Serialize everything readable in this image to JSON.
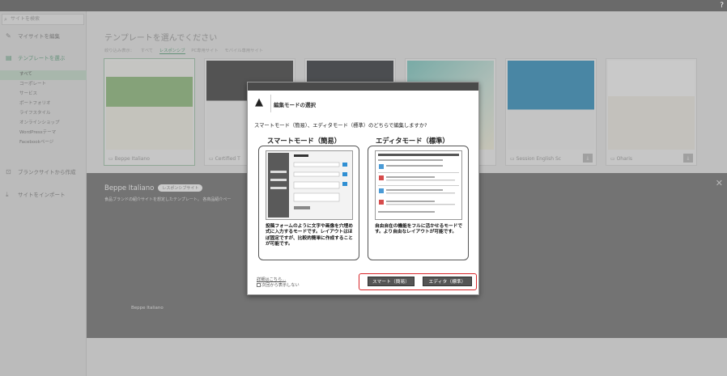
{
  "topbar": {
    "help_icon": "?"
  },
  "sidebar": {
    "search_placeholder": "サイトを検索",
    "items": [
      {
        "label": "マイサイトを編集",
        "icon": "pencil-icon"
      },
      {
        "label": "テンプレートを選ぶ",
        "icon": "template-icon"
      },
      {
        "label": "ブランクサイトから作成",
        "icon": "blank-site-icon"
      },
      {
        "label": "サイトをインポート",
        "icon": "import-icon"
      }
    ],
    "categories": [
      "すべて",
      "コーポレート",
      "サービス",
      "ポートフォリオ",
      "ライフスタイル",
      "オンラインショップ",
      "WordPressテーマ",
      "Facebookページ"
    ]
  },
  "main": {
    "heading": "テンプレートを選んでください",
    "filter_label": "絞り込み表示：",
    "filters": [
      "すべて",
      "レスポンシブ",
      "PC専用サイト",
      "モバイル専用サイト"
    ],
    "cards": [
      {
        "name": "Beppe Italiano"
      },
      {
        "name": "Certified T"
      },
      {
        "name": ""
      },
      {
        "name": ""
      },
      {
        "name": "Session English Sc"
      },
      {
        "name": "Oharis"
      }
    ]
  },
  "detail": {
    "title": "Beppe Italiano",
    "badge": "レスポンシブサイト",
    "description": "食品ブランドの紹介サイトを想定したテンプレート。 各商品紹介ペー",
    "footer_name": "Beppe Italiano"
  },
  "dialog": {
    "title": "編集モードの選択",
    "question": "スマートモード（簡易）、エディタモード（標準）のどちらで編集しますか?",
    "smart": {
      "heading": "スマートモード（簡易）",
      "description": "投稿フォームのように文字や画像を穴埋め式に入力するモードです。レイアウトはほぼ固定ですが、比較的簡単に作成することが可能です。"
    },
    "editor": {
      "heading": "エディタモード（標準）",
      "description": "自由自在の機能をフルに活かせるモードです。より自由なレイアウトが可能です。"
    },
    "more_link": "詳細はこちら…",
    "dont_show": "次回から表示しない",
    "smart_button": "スマート（簡易）",
    "editor_button": "エディタ（標準）"
  }
}
